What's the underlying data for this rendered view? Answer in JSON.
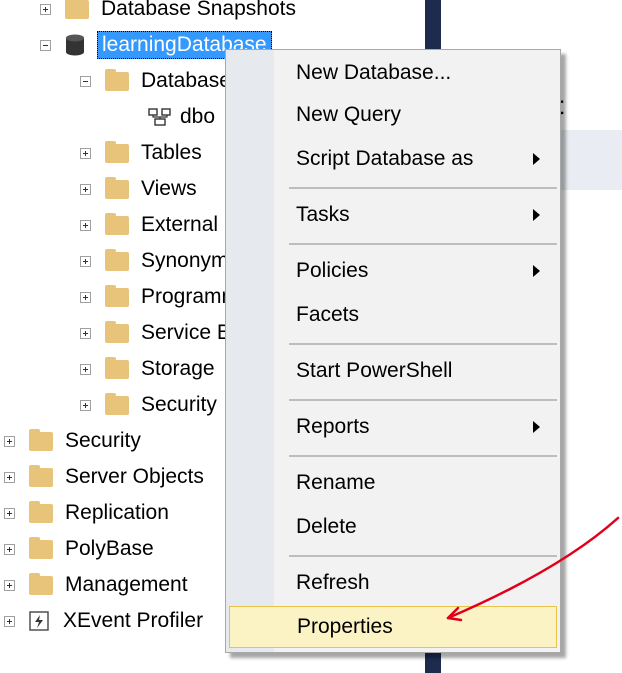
{
  "tree": {
    "database_snapshots": "Database Snapshots",
    "learning_database": "learningDatabase",
    "database_diagrams": "Database Diagrams",
    "dbo": "dbo",
    "tables": "Tables",
    "views": "Views",
    "external": "External Resources",
    "synonyms": "Synonyms",
    "programmability": "Programmability",
    "service_broker": "Service Broker",
    "storage": "Storage",
    "db_security": "Security",
    "security": "Security",
    "server_objects": "Server Objects",
    "replication": "Replication",
    "polybase": "PolyBase",
    "management": "Management",
    "xevent_profiler": "XEvent Profiler"
  },
  "context_menu": {
    "new_database": "New Database...",
    "new_query": "New Query",
    "script_database_as": "Script Database as",
    "tasks": "Tasks",
    "policies": "Policies",
    "facets": "Facets",
    "start_powershell": "Start PowerShell",
    "reports": "Reports",
    "rename": "Rename",
    "delete": "Delete",
    "refresh": "Refresh",
    "properties": "Properties"
  },
  "right_pane": {
    "header_fragment": "t"
  },
  "colors": {
    "selection": "#3399ff",
    "highlight_bg": "#fcf3c5",
    "annotation_arrow": "#e0001b",
    "folder": "#e8c37a"
  }
}
